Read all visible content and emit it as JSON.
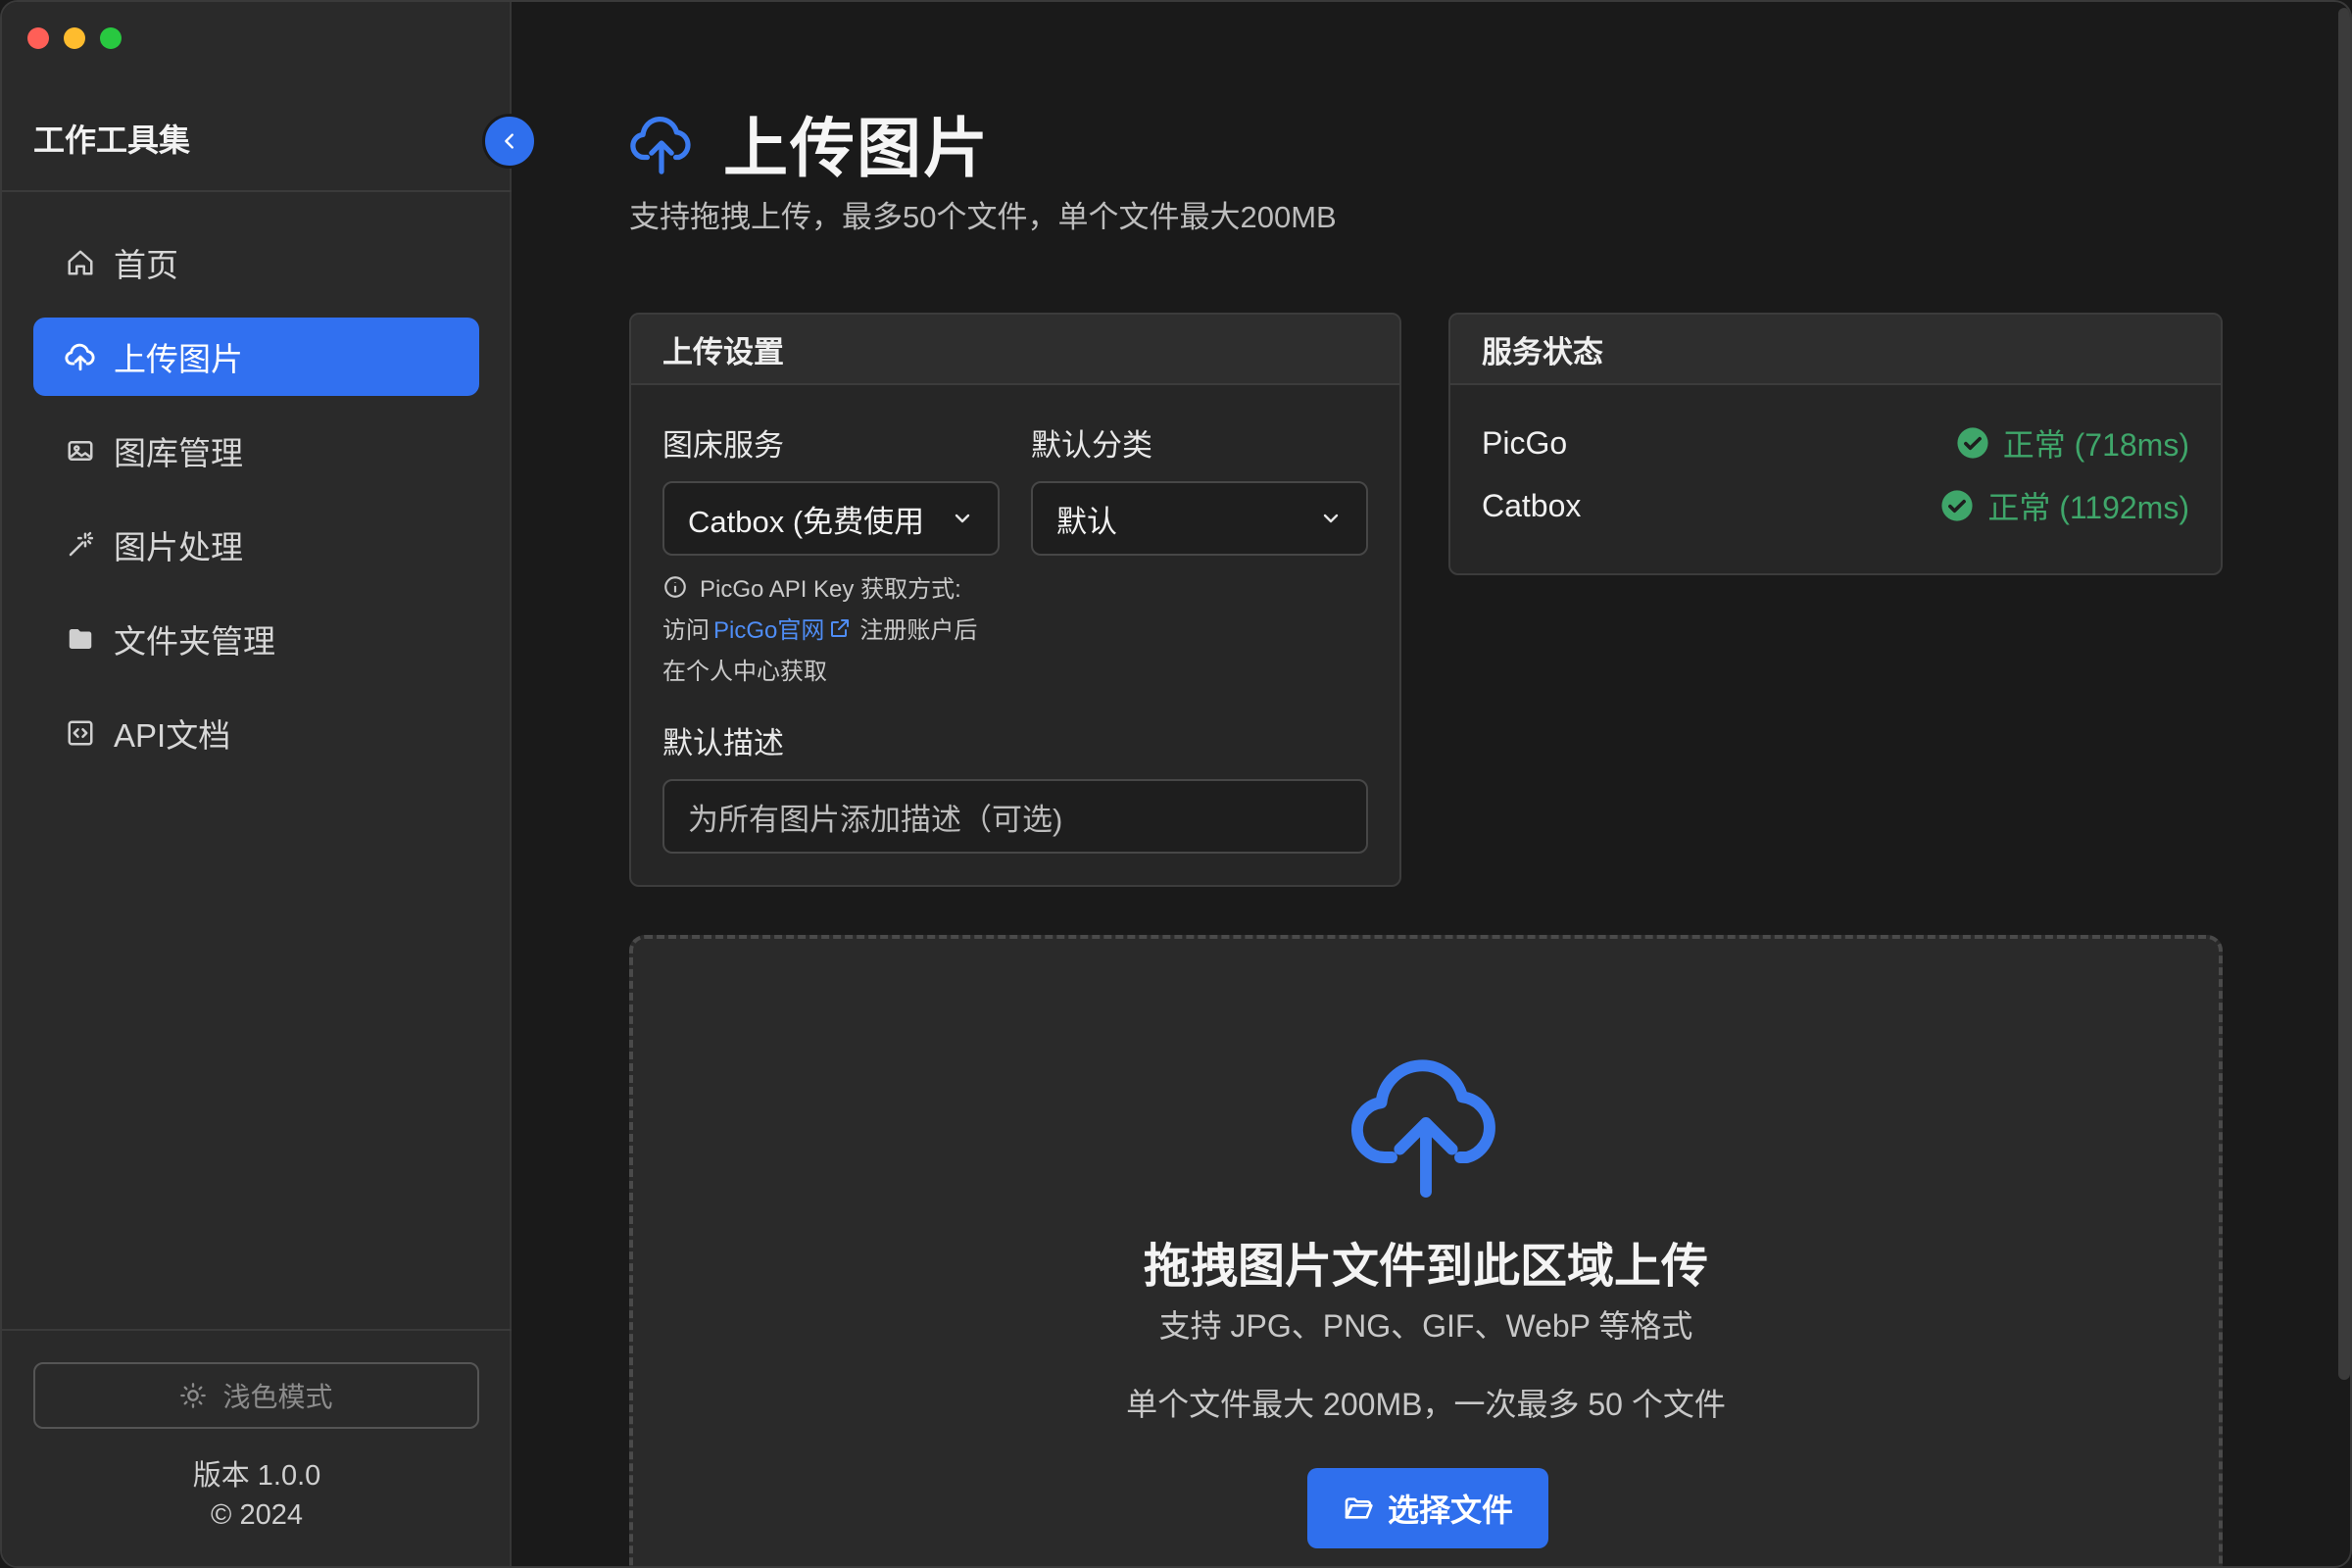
{
  "sidebar": {
    "app_title": "工作工具集",
    "items": [
      {
        "label": "首页",
        "icon": "home-icon"
      },
      {
        "label": "上传图片",
        "icon": "cloud-upload-icon",
        "active": true
      },
      {
        "label": "图库管理",
        "icon": "image-icon"
      },
      {
        "label": "图片处理",
        "icon": "magic-wand-icon"
      },
      {
        "label": "文件夹管理",
        "icon": "folder-icon"
      },
      {
        "label": "API文档",
        "icon": "code-icon"
      }
    ],
    "theme_button": "浅色模式",
    "version": "版本 1.0.0",
    "copyright": "© 2024"
  },
  "main": {
    "title": "上传图片",
    "subtitle": "支持拖拽上传，最多50个文件，单个文件最大200MB",
    "upload_settings": {
      "title": "上传设置",
      "host_label": "图床服务",
      "host_value": "Catbox (免费使用",
      "category_label": "默认分类",
      "category_value": "默认",
      "hint_line1": "PicGo API Key 获取方式:",
      "hint_visit": "访问",
      "hint_link": "PicGo官网",
      "hint_after": "注册账户后",
      "hint_line3": "在个人中心获取",
      "desc_label": "默认描述",
      "desc_placeholder": "为所有图片添加描述（可选)"
    },
    "service_status": {
      "title": "服务状态",
      "services": [
        {
          "name": "PicGo",
          "status": "正常 (718ms)"
        },
        {
          "name": "Catbox",
          "status": "正常 (1192ms)"
        }
      ]
    },
    "dropzone": {
      "title": "拖拽图片文件到此区域上传",
      "formats": "支持 JPG、PNG、GIF、WebP 等格式",
      "limits": "单个文件最大 200MB，一次最多 50 个文件",
      "button": "选择文件"
    }
  },
  "colors": {
    "accent": "#2f6fed",
    "status_ok": "#3fa66a",
    "link": "#4f8df5"
  }
}
